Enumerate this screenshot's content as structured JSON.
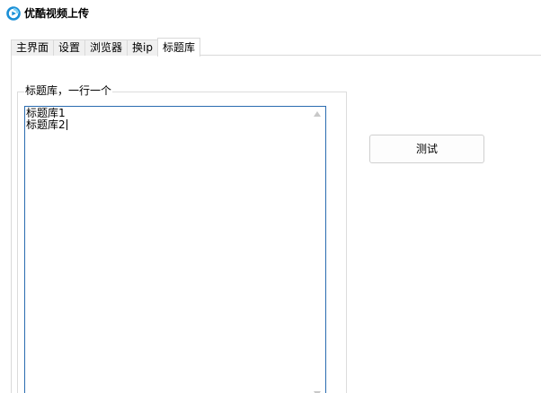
{
  "window": {
    "title": "优酷视频上传",
    "icon": "app-logo-icon",
    "accent_color": "#1a8fd6"
  },
  "tabs": [
    {
      "label": "主界面",
      "active": false
    },
    {
      "label": "设置",
      "active": false
    },
    {
      "label": "浏览器",
      "active": false
    },
    {
      "label": "换ip",
      "active": false
    },
    {
      "label": "标题库",
      "active": true
    }
  ],
  "title_library": {
    "group_label": "标题库，一行一个",
    "lines": [
      "标题库1",
      "标题库2"
    ],
    "test_button_label": "测试"
  }
}
